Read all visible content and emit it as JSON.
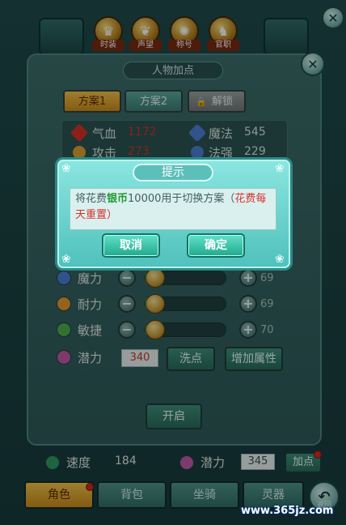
{
  "top_tabs": [
    {
      "label": "时装",
      "icon": "helmet-icon"
    },
    {
      "label": "声望",
      "icon": "frog-icon"
    },
    {
      "label": "称号",
      "icon": "dragon-icon"
    },
    {
      "label": "官职",
      "icon": "lion-icon"
    }
  ],
  "inner_panel": {
    "title": "人物加点",
    "tabs": [
      "方案1",
      "方案2",
      "解锁"
    ]
  },
  "stats": [
    {
      "label": "气血",
      "value": "1172",
      "color": "#d9312a"
    },
    {
      "label": "魔法",
      "value": "545",
      "color": "#d7e6e4"
    },
    {
      "label": "攻击",
      "value": "273",
      "color": "#d9312a"
    },
    {
      "label": "法强",
      "value": "229",
      "color": "#d7e6e4"
    }
  ],
  "attributes": [
    {
      "label": "魔力",
      "value": "69"
    },
    {
      "label": "耐力",
      "value": "69"
    },
    {
      "label": "敏捷",
      "value": "70"
    }
  ],
  "potential": {
    "label": "潜力",
    "value": "340",
    "wash_label": "洗点",
    "add_label": "增加属性"
  },
  "open_label": "开启",
  "summary": {
    "speed_label": "速度",
    "speed_value": "184",
    "potential_label": "潜力",
    "potential_value": "345",
    "add_point_label": "加点"
  },
  "bottom_tabs": [
    "角色",
    "背包",
    "坐骑",
    "灵器"
  ],
  "back_label": "返回",
  "dialog": {
    "title": "提示",
    "message_prefix": "将花费",
    "message_currency": "银币",
    "message_middle": "10000用于切换方案（",
    "message_note": "花费每天重置",
    "message_suffix": "）",
    "cancel_label": "取消",
    "confirm_label": "确定"
  },
  "watermark": "www.365jz.com"
}
